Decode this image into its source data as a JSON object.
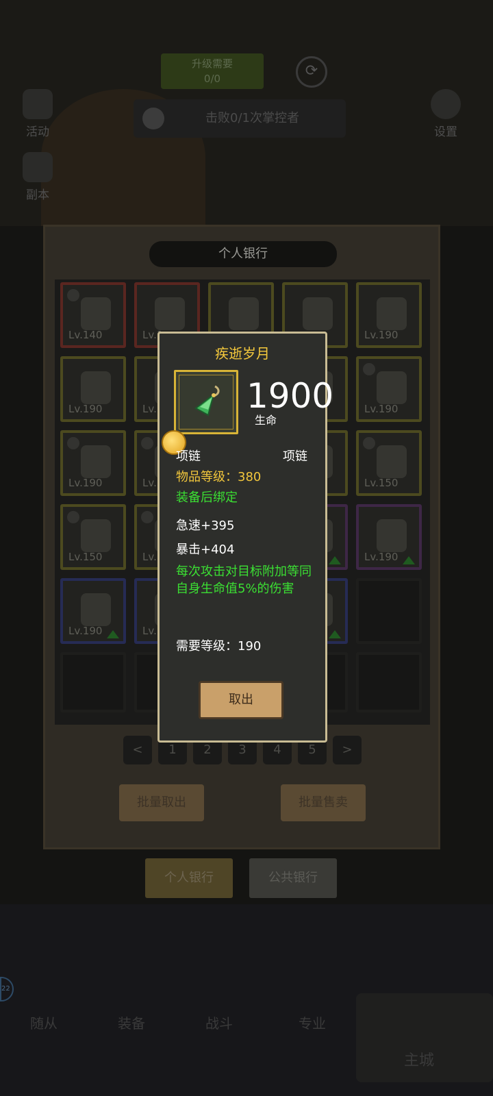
{
  "hud": {
    "exp_line1": "升级需要",
    "exp_line2": "0/0",
    "quest_text": "击败0/1次掌控者",
    "left_buttons": [
      "活动",
      "副本"
    ],
    "settings_label": "设置"
  },
  "bank": {
    "title": "个人银行",
    "slots": [
      {
        "lv": "Lv.140",
        "rarity": "red",
        "locked": true,
        "upgrade": false
      },
      {
        "lv": "Lv.1",
        "rarity": "red",
        "locked": false,
        "upgrade": false
      },
      {
        "lv": "",
        "rarity": "yellow",
        "locked": false,
        "upgrade": false
      },
      {
        "lv": "",
        "rarity": "yellow",
        "locked": false,
        "upgrade": false
      },
      {
        "lv": "Lv.190",
        "rarity": "yellow",
        "locked": false,
        "upgrade": false
      },
      {
        "lv": "Lv.190",
        "rarity": "yellow",
        "locked": false,
        "upgrade": false
      },
      {
        "lv": "Lv.",
        "rarity": "yellow",
        "locked": false,
        "upgrade": false
      },
      {
        "lv": "",
        "rarity": "yellow",
        "locked": false,
        "upgrade": false
      },
      {
        "lv": "",
        "rarity": "yellow",
        "locked": false,
        "upgrade": false
      },
      {
        "lv": "Lv.190",
        "rarity": "yellow",
        "locked": true,
        "upgrade": false
      },
      {
        "lv": "Lv.190",
        "rarity": "yellow",
        "locked": true,
        "upgrade": false
      },
      {
        "lv": "Lv.",
        "rarity": "yellow",
        "locked": true,
        "upgrade": false
      },
      {
        "lv": "",
        "rarity": "yellow",
        "locked": false,
        "upgrade": false
      },
      {
        "lv": "",
        "rarity": "yellow",
        "locked": false,
        "upgrade": false
      },
      {
        "lv": "Lv.150",
        "rarity": "yellow",
        "locked": true,
        "upgrade": false
      },
      {
        "lv": "Lv.150",
        "rarity": "yellow",
        "locked": true,
        "upgrade": false
      },
      {
        "lv": "Lv.",
        "rarity": "yellow",
        "locked": true,
        "upgrade": false
      },
      {
        "lv": "",
        "rarity": "yellow",
        "locked": false,
        "upgrade": false
      },
      {
        "lv": "",
        "rarity": "purple",
        "locked": false,
        "upgrade": true
      },
      {
        "lv": "Lv.190",
        "rarity": "purple",
        "locked": false,
        "upgrade": true
      },
      {
        "lv": "Lv.190",
        "rarity": "blue",
        "locked": false,
        "upgrade": true
      },
      {
        "lv": "Lv.",
        "rarity": "blue",
        "locked": false,
        "upgrade": false
      },
      {
        "lv": "",
        "rarity": "blue",
        "locked": false,
        "upgrade": false
      },
      {
        "lv": "",
        "rarity": "blue",
        "locked": false,
        "upgrade": true
      },
      {
        "lv": "",
        "rarity": "empty",
        "locked": false,
        "upgrade": false
      }
    ],
    "pager": {
      "prev": "<",
      "pages": [
        "1",
        "2",
        "3",
        "4",
        "5"
      ],
      "current": "1",
      "next": ">"
    },
    "batch_withdraw": "批量取出",
    "batch_sell": "批量售卖",
    "tab_personal": "个人银行",
    "tab_public": "公共银行"
  },
  "tooltip": {
    "name": "疾逝岁月",
    "stat_value": "1900",
    "stat_name": "生命",
    "type_left": "项链",
    "type_right": "项链",
    "item_level": "物品等级：380",
    "bind": "装备后绑定",
    "attr1": "急速+395",
    "attr2": "暴击+404",
    "effect": "每次攻击对目标附加等同自身生命值5%的伤害",
    "required_level": "需要等级：190",
    "cancel_label": "取出"
  },
  "bottom_nav": {
    "items": [
      "随从",
      "装备",
      "战斗",
      "专业"
    ],
    "main": "主城",
    "badge": "22"
  }
}
